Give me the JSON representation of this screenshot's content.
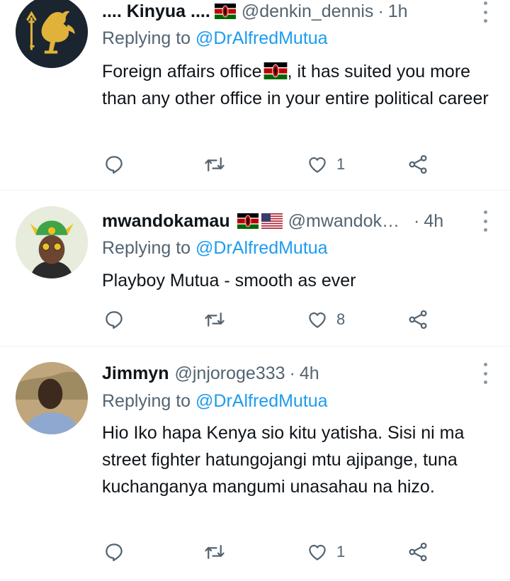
{
  "tweets": [
    {
      "name": ".... Kinyua ....",
      "flags": [
        "kenya"
      ],
      "handle": "@denkin_dennis",
      "dot": "·",
      "time": "1h",
      "replying_prefix": "Replying to ",
      "replying_to": "@DrAlfredMutua",
      "text_parts": [
        "Foreign affairs office",
        ", it has suited you more than any other office in your entire political career"
      ],
      "inline_flag": "kenya",
      "like_count": "1"
    },
    {
      "name": "mwandokamau",
      "flags": [
        "kenya",
        "usa"
      ],
      "handle": "@mwandok…",
      "dot": "·",
      "time": "4h",
      "replying_prefix": "Replying to ",
      "replying_to": "@DrAlfredMutua",
      "text": "Playboy Mutua - smooth as ever",
      "like_count": "8"
    },
    {
      "name": "Jimmyn",
      "handle": "@jnjoroge333",
      "dot": "·",
      "time": "4h",
      "replying_prefix": "Replying to ",
      "replying_to": "@DrAlfredMutua",
      "text": "Hio Iko hapa Kenya sio kitu yatisha. Sisi ni ma street fighter hatungojangi mtu ajipange, tuna kuchanganya mangumi unasahau na hizo.",
      "like_count": "1"
    }
  ],
  "colors": {
    "text": "#0f1419",
    "secondary": "#536471",
    "link": "#1d9bf0",
    "divider": "#eff3f4"
  },
  "icons": [
    "reply-icon",
    "retweet-icon",
    "like-icon",
    "share-icon",
    "more-icon",
    "kenya-flag-icon",
    "usa-flag-icon"
  ]
}
